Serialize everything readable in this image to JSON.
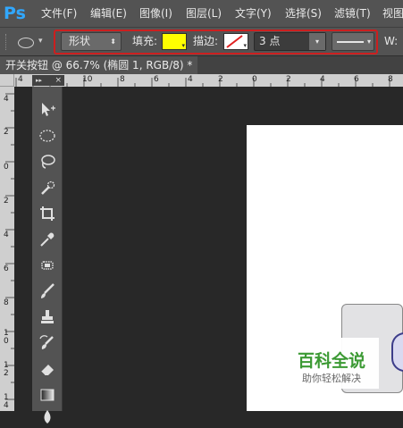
{
  "app": {
    "logo": "Ps"
  },
  "menu": {
    "items": [
      "文件(F)",
      "编辑(E)",
      "图像(I)",
      "图层(L)",
      "文字(Y)",
      "选择(S)",
      "滤镜(T)",
      "视图"
    ]
  },
  "options_bar": {
    "tool_icon": "ellipse-tool-icon",
    "mode": "形状",
    "fill_label": "填充:",
    "fill_color": "#ffff00",
    "stroke_label": "描边:",
    "stroke_color": "none",
    "stroke_width": "3 点",
    "w_label": "W:",
    "highlight_color": "#cc1f1f"
  },
  "document": {
    "tab_title": "开关按钮 @ 66.7% (椭圆 1, RGB/8) *"
  },
  "rulers": {
    "top": [
      "4",
      "2",
      "10",
      "8",
      "6",
      "4",
      "2",
      "0",
      "2",
      "4",
      "6",
      "8"
    ],
    "left": [
      "4",
      "2",
      "0",
      "2",
      "4",
      "6",
      "8",
      "1 0",
      "1 2",
      "1 4"
    ]
  },
  "toolbox": {
    "header_glyph": "▸▸",
    "close_glyph": "×",
    "tools": [
      "move-tool-icon",
      "elliptical-marquee-icon",
      "lasso-icon",
      "quick-selection-icon",
      "crop-icon",
      "eyedropper-icon",
      "healing-brush-icon",
      "brush-icon",
      "clone-stamp-icon",
      "history-brush-icon",
      "eraser-icon",
      "gradient-icon",
      "blur-icon"
    ]
  },
  "watermark": {
    "title": "百科全说",
    "subtitle": "助你轻松解决"
  }
}
